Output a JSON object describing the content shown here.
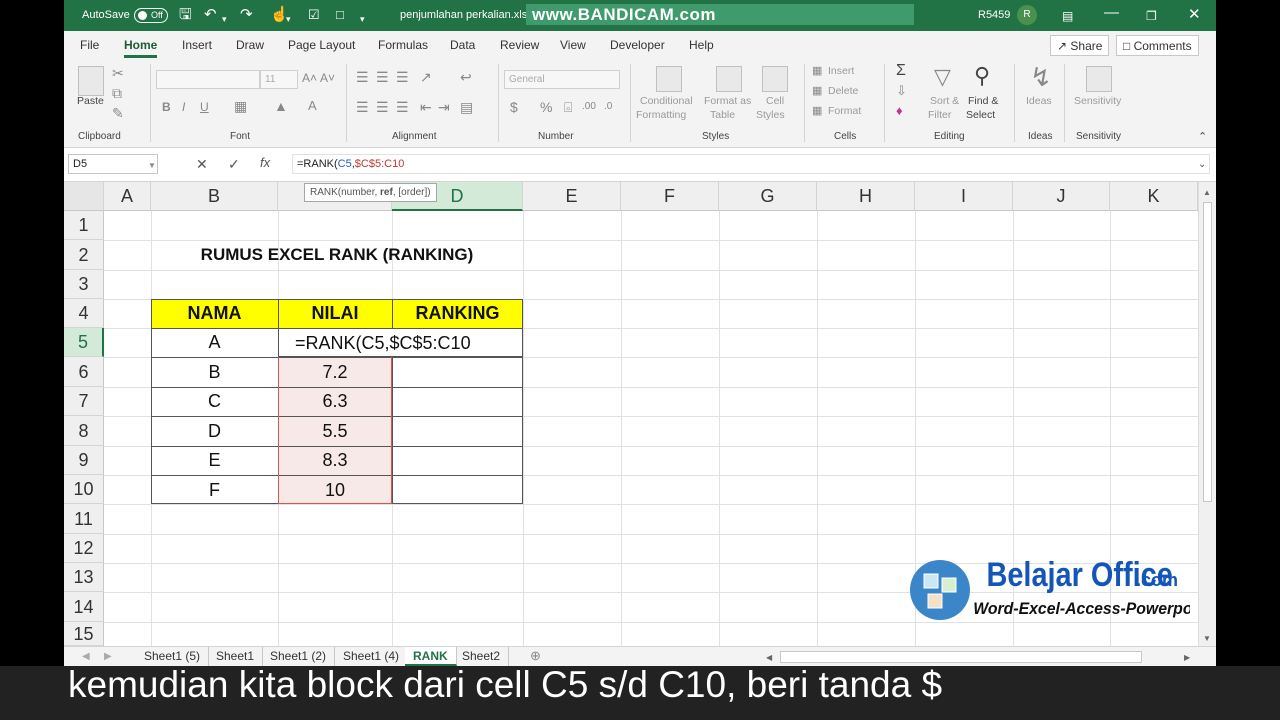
{
  "titlebar": {
    "autosave_label": "AutoSave",
    "autosave_state": "Off",
    "filename": "penjumlahan perkalian.xlsx",
    "watermark": "www.BANDICAM.com",
    "user_code": "R5459",
    "user_initial": "R"
  },
  "tabs": [
    "File",
    "Home",
    "Insert",
    "Draw",
    "Page Layout",
    "Formulas",
    "Data",
    "Review",
    "View",
    "Developer",
    "Help"
  ],
  "active_tab": "Home",
  "share_label": "Share",
  "comments_label": "Comments",
  "ribbon": {
    "clipboard": {
      "paste": "Paste",
      "label": "Clipboard"
    },
    "font": {
      "size": "11",
      "label": "Font"
    },
    "alignment": {
      "label": "Alignment"
    },
    "number": {
      "format": "General",
      "label": "Number"
    },
    "styles": {
      "conditional": "Conditional",
      "formatting": "Formatting",
      "format_as": "Format as",
      "table": "Table",
      "cell": "Cell",
      "cell_styles": "Styles",
      "label": "Styles"
    },
    "cells": {
      "insert": "Insert",
      "delete": "Delete",
      "format": "Format",
      "label": "Cells"
    },
    "editing": {
      "sort": "Sort &",
      "filter": "Filter",
      "find": "Find &",
      "select": "Select",
      "label": "Editing"
    },
    "ideas": {
      "name": "Ideas",
      "label": "Ideas"
    },
    "sensitivity": {
      "name": "Sensitivity",
      "label": "Sensitivity"
    }
  },
  "formula_bar": {
    "name_box": "D5",
    "formula_prefix": "=RANK(",
    "ref1": "C5",
    "comma": ",",
    "ref2": "$C$5:C10",
    "tooltip_pre": "RANK(number, ",
    "tooltip_bold": "ref",
    "tooltip_post": ", [order])"
  },
  "grid": {
    "columns": [
      "A",
      "B",
      "C",
      "D",
      "E",
      "F",
      "G",
      "H",
      "I",
      "J",
      "K"
    ],
    "rows": [
      "1",
      "2",
      "3",
      "4",
      "5",
      "6",
      "7",
      "8",
      "9",
      "10",
      "11",
      "12",
      "13",
      "14",
      "15"
    ],
    "title": "RUMUS EXCEL RANK (RANKING)",
    "headers": [
      "NAMA",
      "NILAI",
      "RANKING"
    ],
    "data": [
      {
        "nama": "A",
        "nilai": ""
      },
      {
        "nama": "B",
        "nilai": "7.2"
      },
      {
        "nama": "C",
        "nilai": "6.3"
      },
      {
        "nama": "D",
        "nilai": "5.5"
      },
      {
        "nama": "E",
        "nilai": "8.3"
      },
      {
        "nama": "F",
        "nilai": "10"
      }
    ],
    "editing_text": "=RANK(C5,$C$5:C10"
  },
  "sheets": [
    "Sheet1 (5)",
    "Sheet1",
    "Sheet1 (2)",
    "Sheet1 (4)",
    "RANK",
    "Sheet2"
  ],
  "active_sheet": "RANK",
  "logo": {
    "line1": "Belajar Office",
    "line1b": ".com",
    "line2": "Word-Excel-Access-Powerpoint"
  },
  "caption": "kemudian kita block dari cell C5 s/d C10, beri tanda $",
  "colors": {
    "excel_green": "#217346",
    "header_yellow": "#ffff00",
    "range_pink": "#f8e9e9"
  }
}
